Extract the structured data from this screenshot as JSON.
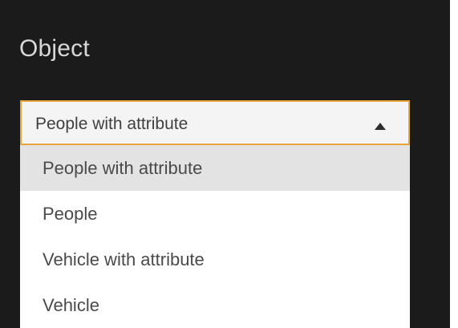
{
  "section": {
    "title": "Object"
  },
  "select": {
    "value": "People with attribute",
    "expanded": true,
    "options": [
      "People with attribute",
      "People",
      "Vehicle with attribute",
      "Vehicle"
    ],
    "selected_index": 0
  },
  "colors": {
    "background": "#1b1b1b",
    "accent": "#e8a63a",
    "select_bg": "#f4f4f4",
    "selected_option_bg": "#e3e3e3"
  },
  "icons": {
    "caret": "triangle-up-icon"
  }
}
